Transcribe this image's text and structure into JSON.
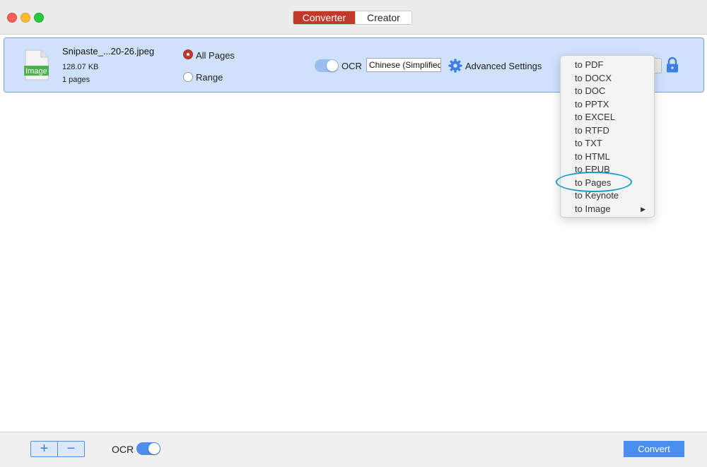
{
  "header": {
    "tabs": [
      {
        "label": "Converter",
        "active": true
      },
      {
        "label": "Creator",
        "active": false
      }
    ]
  },
  "file": {
    "icon_label": "Image",
    "name": "Snipaste_...20-26.jpeg",
    "size": "128.07 KB",
    "pages": "1 pages",
    "page_options": [
      "All Pages",
      "Range"
    ],
    "selected_page_option": "All Pages",
    "ocr_label": "OCR",
    "ocr_enabled": true,
    "language": "Chinese (Simplified)",
    "advanced_label": "Advanced Settings"
  },
  "menu": {
    "items": [
      "to PDF",
      "to DOCX",
      "to DOC",
      "to PPTX",
      "to EXCEL",
      "to RTFD",
      "to TXT",
      "to HTML",
      "to EPUB",
      "to Pages",
      "to Keynote",
      "to Image"
    ],
    "highlighted": "to Pages"
  },
  "footer": {
    "add_label": "+",
    "remove_label": "−",
    "ocr_label": "OCR",
    "ocr_enabled": true,
    "convert_label": "Convert"
  },
  "colors": {
    "accent_red": "#c0392b",
    "accent_blue": "#4a8ff0",
    "row_selected": "#cfe1fb",
    "annotation": "#1b9cc9"
  }
}
